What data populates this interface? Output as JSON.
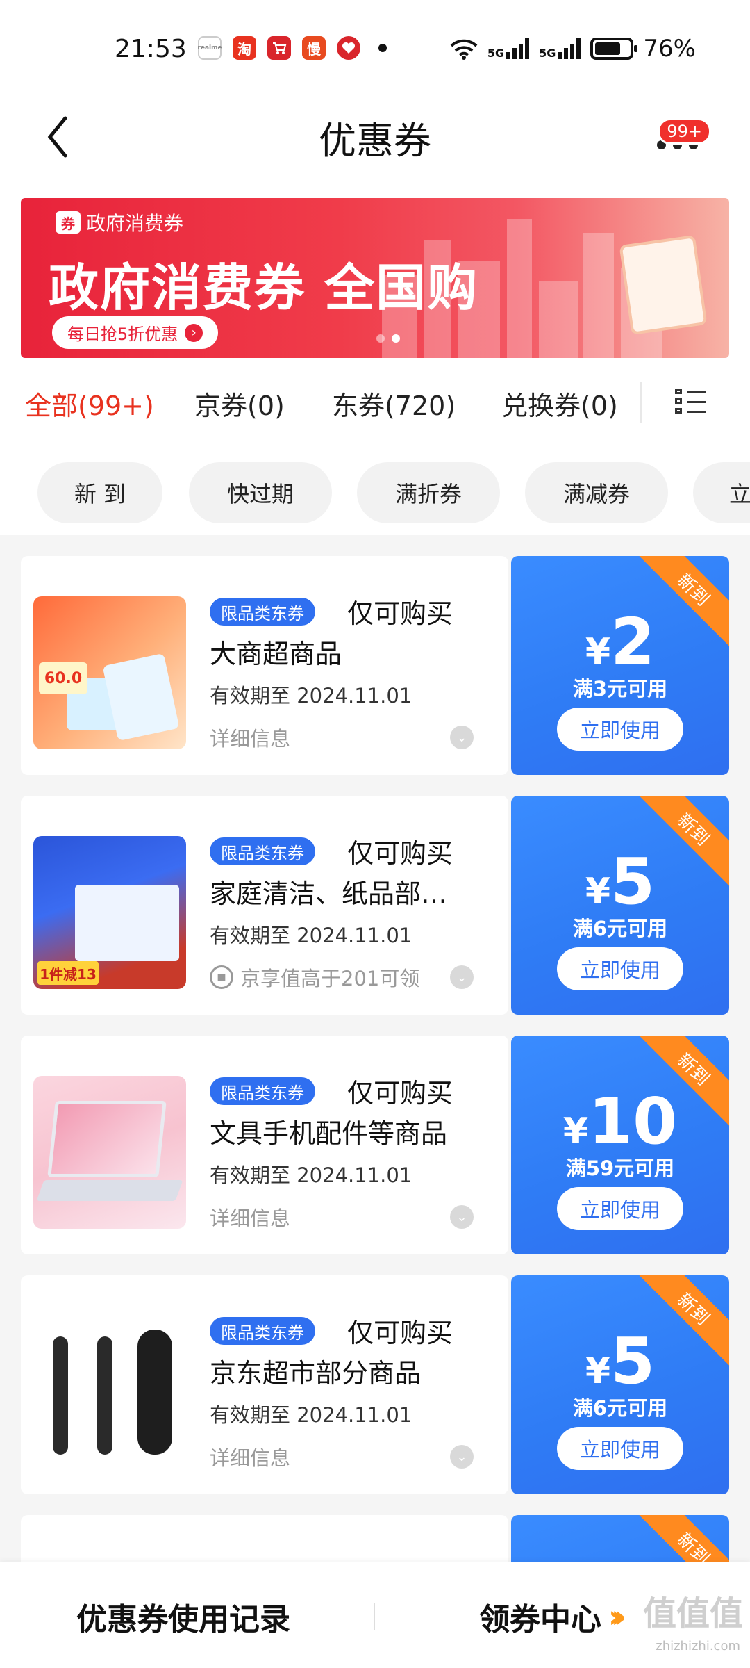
{
  "status_bar": {
    "time": "21:53",
    "apps": [
      {
        "icon": "realme-icon",
        "label": "realme",
        "color": "#ffffff"
      },
      {
        "icon": "taobao-icon",
        "label": "淘",
        "color": "#e8321f"
      },
      {
        "icon": "cart-icon",
        "label": "",
        "color": "#d9252b"
      },
      {
        "icon": "manman-icon",
        "label": "慢",
        "color": "#e84a1f"
      },
      {
        "icon": "heart-icon",
        "label": "",
        "color": "#d9252b"
      }
    ],
    "network1": "5G",
    "network2": "5G",
    "battery_level": 0.76,
    "battery_text": "76%"
  },
  "header": {
    "title": "优惠券",
    "badge": "99+"
  },
  "banner": {
    "tag": "政府消费券",
    "tag_icon_text": "券",
    "headline": "政府消费券 全国购",
    "button": "每日抢5折优惠"
  },
  "tabs": [
    {
      "label": "全部(99+)",
      "active": true
    },
    {
      "label": "京券(0)",
      "active": false
    },
    {
      "label": "东券(720)",
      "active": false
    },
    {
      "label": "兑换券(0)",
      "active": false
    }
  ],
  "chips": [
    "新 到",
    "快过期",
    "满折券",
    "满减券",
    "立"
  ],
  "coupons": [
    {
      "tag": "限品类东券",
      "title_line1": "仅可购买",
      "title_line2": "大商超商品",
      "valid": "有效期至 2024.11.01",
      "detail": "详细信息",
      "currency": "¥",
      "amount": "2",
      "condition": "满3元可用",
      "button": "立即使用",
      "ribbon": "新到",
      "thumb_text": "60.0"
    },
    {
      "tag": "限品类东券",
      "title_line1": "仅可购买",
      "title_line2": "家庭清洁、纸品部…",
      "valid": "有效期至 2024.11.01",
      "detail": "京享值高于201可领",
      "currency": "¥",
      "amount": "5",
      "condition": "满6元可用",
      "button": "立即使用",
      "ribbon": "新到",
      "thumb_text": "1件减13"
    },
    {
      "tag": "限品类东券",
      "title_line1": "仅可购买",
      "title_line2": "文具手机配件等商品",
      "valid": "有效期至 2024.11.01",
      "detail": "详细信息",
      "currency": "¥",
      "amount": "10",
      "condition": "满59元可用",
      "button": "立即使用",
      "ribbon": "新到"
    },
    {
      "tag": "限品类东券",
      "title_line1": "仅可购买",
      "title_line2": "京东超市部分商品",
      "valid": "有效期至 2024.11.01",
      "detail": "详细信息",
      "currency": "¥",
      "amount": "5",
      "condition": "满6元可用",
      "button": "立即使用",
      "ribbon": "新到"
    },
    {
      "ribbon": "新到"
    }
  ],
  "bottom_bar": {
    "left": "优惠券使用记录",
    "right": "领券中心",
    "watermark": "值值值",
    "watermark_url": "zhizhizhi.com"
  },
  "colors": {
    "accent_red": "#e8321f",
    "coupon_blue": "#2f6ff0",
    "ribbon_orange": "#ff8a1f"
  }
}
